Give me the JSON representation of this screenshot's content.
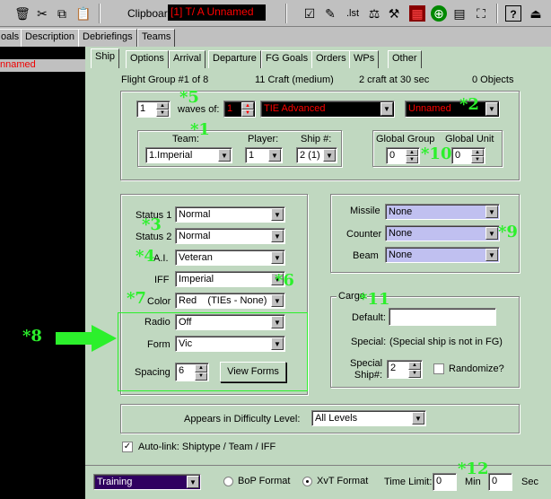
{
  "toolbar": {
    "clipboard_label": "Clipboard:",
    "clipboard_value": "[1] T/ A Unnamed",
    "lst_label": ".lst",
    "help_label": "?"
  },
  "top_tabs": [
    "oals",
    "Description",
    "Debriefings",
    "Teams"
  ],
  "left_list": {
    "selected_item": "nnamed"
  },
  "ship_tabs": [
    "Ship",
    "Options",
    "Arrival",
    "Departure",
    "FG Goals",
    "Orders",
    "WPs",
    "Other"
  ],
  "header": {
    "flight_group": "Flight Group #1 of 8",
    "craft_count": "11 Craft (medium)",
    "craft_speed": "2 craft at 30 sec",
    "objects": "0 Objects"
  },
  "waves": {
    "count": "1",
    "label": "waves of:",
    "craft_num": "1",
    "ship_type": "TIE Advanced",
    "name": "Unnamed"
  },
  "team": {
    "label": "Team:",
    "value": "1.Imperial"
  },
  "player": {
    "label": "Player:",
    "value": "1"
  },
  "ship_num": {
    "label": "Ship #:",
    "value": "2 (1)"
  },
  "global": {
    "group_label": "Global Group",
    "group_value": "0",
    "unit_label": "Global Unit",
    "unit_value": "0"
  },
  "status1": {
    "label": "Status 1",
    "value": "Normal"
  },
  "status2": {
    "label": "Status 2",
    "value": "Normal"
  },
  "ai": {
    "label": "A.I.",
    "value": "Veteran"
  },
  "iff": {
    "label": "IFF",
    "value": "Imperial"
  },
  "color": {
    "label": "Color",
    "value": "Red    (TIEs - None)"
  },
  "radio_field": {
    "label": "Radio",
    "value": "Off"
  },
  "form": {
    "label": "Form",
    "value": "Vic"
  },
  "spacing": {
    "label": "Spacing",
    "value": "6",
    "view_forms": "View Forms"
  },
  "missile": {
    "label": "Missile",
    "value": "None"
  },
  "counter": {
    "label": "Counter",
    "value": "None"
  },
  "beam": {
    "label": "Beam",
    "value": "None"
  },
  "cargo": {
    "title": "Cargo",
    "default_label": "Default:",
    "default_value": "",
    "special_label": "Special:",
    "special_text": "(Special ship is not in FG)",
    "special_ship_label": "Special\nShip#:",
    "special_ship_value": "2",
    "randomize_label": "Randomize?"
  },
  "difficulty": {
    "label": "Appears in Difficulty Level:",
    "value": "All Levels"
  },
  "autolink": {
    "label": "Auto-link:  Shiptype / Team / IFF",
    "checked": true
  },
  "bottom": {
    "mode": "Training",
    "bop_label": "BoP Format",
    "xvt_label": "XvT Format",
    "time_limit_label": "Time Limit:",
    "min_value": "0",
    "min_label": "Min",
    "sec_value": "0",
    "sec_label": "Sec"
  },
  "annotations": {
    "a1": "*1",
    "a2": "*2",
    "a3": "*3",
    "a4": "*4",
    "a5": "*5",
    "a6": "*6",
    "a7": "*7",
    "a8": "*8",
    "a9": "*9",
    "a10": "*10",
    "a11": "*11",
    "a12": "*12"
  },
  "colors": {
    "panel_bg": "#c0d8c0",
    "annotation": "#2cf02c",
    "selection_dark": "#000000",
    "text_red": "#ff0000",
    "lavender": "#c0c0f0"
  }
}
